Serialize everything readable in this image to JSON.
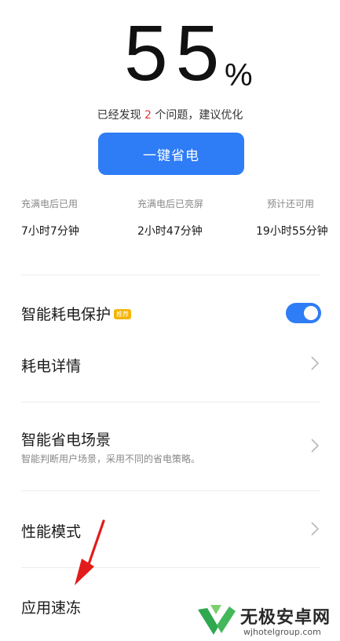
{
  "battery": {
    "percent": "55",
    "unit": "%"
  },
  "issue": {
    "prefix": "已经发现 ",
    "count": "2",
    "suffix": " 个问题，建议优化"
  },
  "save_button": {
    "label": "一键省电"
  },
  "stats": [
    {
      "label": "充满电后已用",
      "value": "7小时7分钟"
    },
    {
      "label": "充满电后已亮屏",
      "value": "2小时47分钟"
    },
    {
      "label": "预计还可用",
      "value": "19小时55分钟"
    }
  ],
  "settings": {
    "smart_protect": {
      "title": "智能耗电保护",
      "tag": "推荐",
      "enabled": true
    },
    "usage_detail": {
      "title": "耗电详情"
    },
    "smart_scene": {
      "title": "智能省电场景",
      "subtitle": "智能判断用户场景，采用不同的省电策略。"
    },
    "performance_mode": {
      "title": "性能模式"
    },
    "app_freeze": {
      "title": "应用速冻"
    }
  },
  "watermark": {
    "title": "无极安卓网",
    "url": "wjhotelgroup.com"
  },
  "colors": {
    "accent": "#2e7cf6",
    "issue_count": "#e53935",
    "tag": "#f5b400",
    "arrow": "#e21b1b"
  }
}
